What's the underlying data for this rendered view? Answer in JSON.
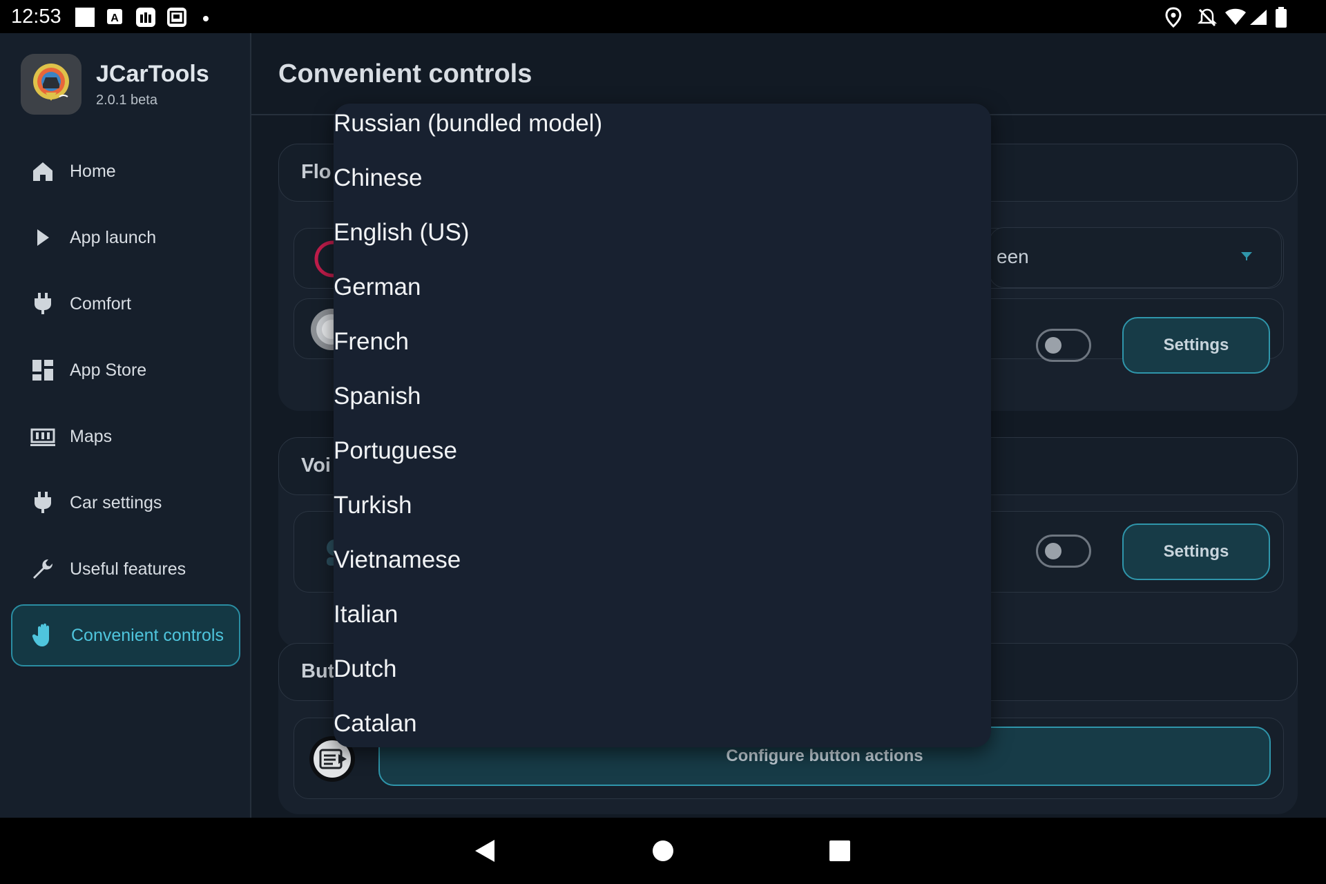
{
  "status_bar": {
    "time": "12:53",
    "left_icons": [
      "white-square-icon",
      "a-badge-icon",
      "store-bag-icon",
      "gallery-icon",
      "dot-icon"
    ],
    "right_icons": [
      "location-pin-icon",
      "notifications-off-icon",
      "wifi-icon",
      "cell-signal-icon",
      "battery-icon"
    ]
  },
  "app": {
    "name": "JCarTools",
    "version": "2.0.1 beta"
  },
  "sidebar": {
    "items": [
      {
        "label": "Home",
        "icon": "home-icon"
      },
      {
        "label": "App launch",
        "icon": "play-icon"
      },
      {
        "label": "Comfort",
        "icon": "plug-icon"
      },
      {
        "label": "App Store",
        "icon": "dashboard-icon"
      },
      {
        "label": "Maps",
        "icon": "map-icon"
      },
      {
        "label": "Car settings",
        "icon": "plug-icon"
      },
      {
        "label": "Useful features",
        "icon": "wrench-icon"
      },
      {
        "label": "Convenient controls",
        "icon": "hand-icon",
        "active": true
      }
    ]
  },
  "page": {
    "title": "Convenient controls"
  },
  "sections": {
    "floating": {
      "header_visible": "Flo",
      "select_visible": "een",
      "toggle_on": false,
      "settings_label": "Settings"
    },
    "voice": {
      "header_visible": "Voi",
      "toggle_on": false,
      "settings_label": "Settings"
    },
    "buttons": {
      "header_visible": "But",
      "configure_label": "Configure button actions"
    }
  },
  "dropdown": {
    "options": [
      "Russian (bundled model)",
      "Chinese",
      "English (US)",
      "German",
      "French",
      "Spanish",
      "Portuguese",
      "Turkish",
      "Vietnamese",
      "Italian",
      "Dutch",
      "Catalan"
    ]
  },
  "colors": {
    "accent": "#4fc5dd",
    "accent_border": "#2f96ab",
    "background": "#121a24",
    "surface": "#18212d"
  },
  "nav_bar": {
    "icons": [
      "back-icon",
      "home-circle-icon",
      "recents-icon"
    ]
  }
}
